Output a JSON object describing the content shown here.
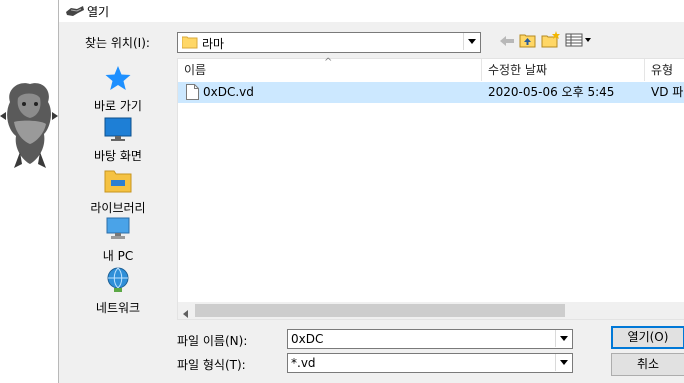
{
  "window": {
    "title": "열기"
  },
  "lookin": {
    "label": "찾는 위치(I):",
    "value": "라마"
  },
  "places": [
    {
      "label": "바로 가기",
      "icon": "quick-access-star-icon"
    },
    {
      "label": "바탕 화면",
      "icon": "desktop-icon"
    },
    {
      "label": "라이브러리",
      "icon": "libraries-folder-icon"
    },
    {
      "label": "내 PC",
      "icon": "this-pc-icon"
    },
    {
      "label": "네트워크",
      "icon": "network-icon"
    }
  ],
  "columns": {
    "name": "이름",
    "date": "수정한 날짜",
    "type": "유형"
  },
  "files": [
    {
      "name": "0xDC.vd",
      "date": "2020-05-06 오후 5:45",
      "type": "VD 파"
    }
  ],
  "filename": {
    "label": "파일 이름(N):",
    "value": "0xDC"
  },
  "filetype": {
    "label": "파일 형식(T):",
    "value": "*.vd"
  },
  "buttons": {
    "open": "열기(O)",
    "cancel": "취소"
  },
  "colors": {
    "selection": "#cce8ff",
    "folder": "#ffd766",
    "accent": "#0078d7"
  }
}
